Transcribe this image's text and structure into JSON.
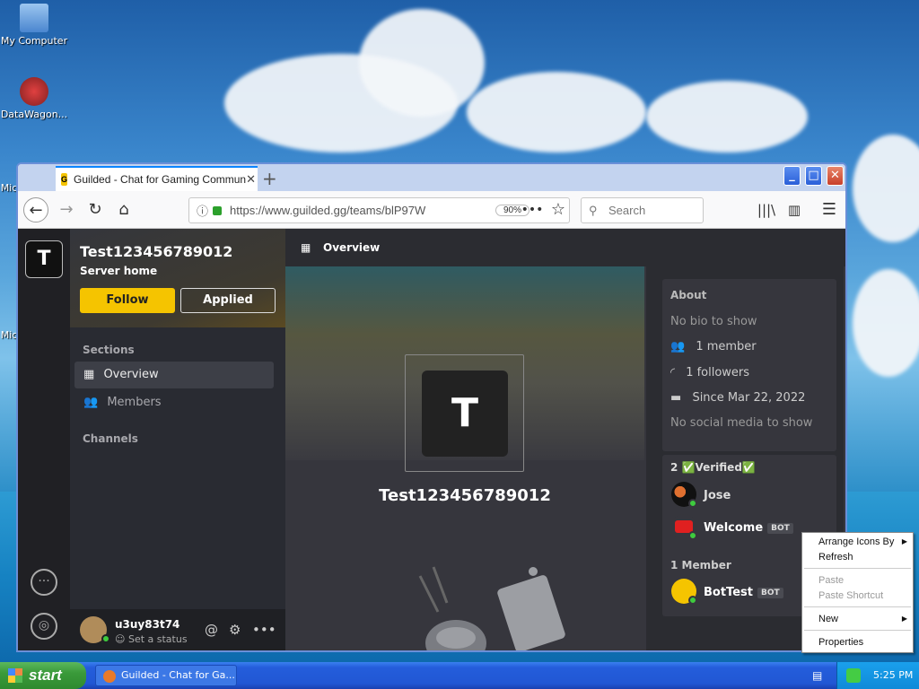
{
  "desktop": {
    "icons": [
      {
        "label": "My Computer"
      },
      {
        "label": "DataWagon..."
      },
      {
        "label": "Mic"
      },
      {
        "label": "Mic"
      }
    ]
  },
  "browser": {
    "tab_title": "Guilded - Chat for Gaming Commun",
    "favicon_letter": "G",
    "tab_close": "✕",
    "new_tab": "+",
    "window_buttons": {
      "minimize": "_",
      "maximize": "□",
      "close": "✕"
    },
    "url": "https://www.guilded.gg/teams/blP97W",
    "zoom": "90%",
    "search_placeholder": "Search"
  },
  "app": {
    "server_letter": "T",
    "server_name": "Test123456789012",
    "server_subtitle": "Server home",
    "follow_label": "Follow",
    "applied_label": "Applied",
    "sections_header": "Sections",
    "section_items": [
      {
        "label": "Overview",
        "icon": "grid-icon"
      },
      {
        "label": "Members",
        "icon": "members-icon"
      }
    ],
    "channels_header": "Channels",
    "user": {
      "name": "u3uy83t74",
      "status": "Set a status"
    },
    "page_title": "Overview",
    "hero_name": "Test123456789012",
    "about": {
      "header": "About",
      "bio": "No bio to show",
      "members": "1 member",
      "followers": "1 followers",
      "since": "Since Mar 22, 2022",
      "social": "No social media to show"
    },
    "groups": [
      {
        "count": "2",
        "name": "✅Verified✅",
        "members": [
          {
            "name": "Jose",
            "bot": ""
          },
          {
            "name": "Welcome",
            "bot": "BOT"
          }
        ]
      },
      {
        "count": "1",
        "name": "Member",
        "members": [
          {
            "name": "BotTest",
            "bot": "BOT"
          }
        ]
      }
    ]
  },
  "context_menu": {
    "items": [
      {
        "label": "Arrange Icons By",
        "disabled": false,
        "submenu": true
      },
      {
        "label": "Refresh",
        "disabled": false,
        "submenu": false
      },
      {
        "label": "Paste",
        "disabled": true,
        "submenu": false
      },
      {
        "label": "Paste Shortcut",
        "disabled": true,
        "submenu": false
      },
      {
        "label": "New",
        "disabled": false,
        "submenu": true
      },
      {
        "label": "Properties",
        "disabled": false,
        "submenu": false
      }
    ]
  },
  "taskbar": {
    "start_label": "start",
    "task_label": "Guilded - Chat for Ga...",
    "clock": "5:25 PM"
  },
  "colors": {
    "accent_yellow": "#f5c400",
    "online_green": "#3ecb3e",
    "xp_blue": "#245ddb"
  }
}
